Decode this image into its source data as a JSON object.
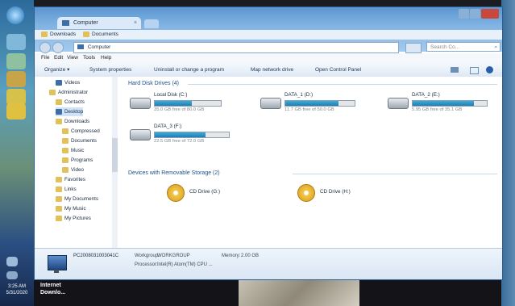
{
  "window": {
    "title": "Computer",
    "bookmarks": [
      "Downloads",
      "Documents"
    ],
    "address": "Computer",
    "search_placeholder": "Search Co..."
  },
  "menu": [
    "File",
    "Edit",
    "View",
    "Tools",
    "Help"
  ],
  "commands": [
    "Organize ▾",
    "System properties",
    "Uninstall or change a program",
    "Map network drive",
    "Open Control Panel"
  ],
  "tree": [
    {
      "label": "Videos",
      "indent": 1
    },
    {
      "label": "Administrator",
      "indent": 0
    },
    {
      "label": "Contacts",
      "indent": 1
    },
    {
      "label": "Desktop",
      "indent": 1
    },
    {
      "label": "Downloads",
      "indent": 1
    },
    {
      "label": "Compressed",
      "indent": 2
    },
    {
      "label": "Documents",
      "indent": 2
    },
    {
      "label": "Music",
      "indent": 2
    },
    {
      "label": "Programs",
      "indent": 2
    },
    {
      "label": "Video",
      "indent": 2
    },
    {
      "label": "Favorites",
      "indent": 1
    },
    {
      "label": "Links",
      "indent": 1
    },
    {
      "label": "My Documents",
      "indent": 1
    },
    {
      "label": "My Music",
      "indent": 1
    },
    {
      "label": "My Pictures",
      "indent": 1
    }
  ],
  "groups": {
    "hdd": "Hard Disk Drives (4)",
    "removable": "Devices with Removable Storage (2)"
  },
  "drives": [
    {
      "name": "Local Disk (C:)",
      "free": "35.0 GB free of 80.0 GB",
      "used_pct": 56
    },
    {
      "name": "DATA_1 (D:)",
      "free": "11.7 GB free of 50.0 GB",
      "used_pct": 77
    },
    {
      "name": "DATA_2 (E:)",
      "free": "5.95 GB free of 35.1 GB",
      "used_pct": 83
    },
    {
      "name": "DATA_3 (F:)",
      "free": "22.5 GB free of 72.0 GB",
      "used_pct": 69
    }
  ],
  "cd_drives": [
    {
      "name": "CD Drive (G:)"
    },
    {
      "name": "CD Drive (H:)"
    }
  ],
  "details": {
    "computer": "PC2008031003041C",
    "workgroup_label": "Workgroup:",
    "workgroup": "WORKGROUP",
    "memory_label": "Memory:",
    "memory": "2.00 GB",
    "processor_label": "Processor:",
    "processor": "Intel(R) Atom(TM) CPU ..."
  },
  "clock": {
    "time": "3:25 AM",
    "date": "5/31/2020"
  },
  "taskbar_item": "Internet Downlo...",
  "colors": {
    "accent": "#1f7fb3",
    "frame": "#5b95cf",
    "group_text": "#1e4f8c"
  }
}
